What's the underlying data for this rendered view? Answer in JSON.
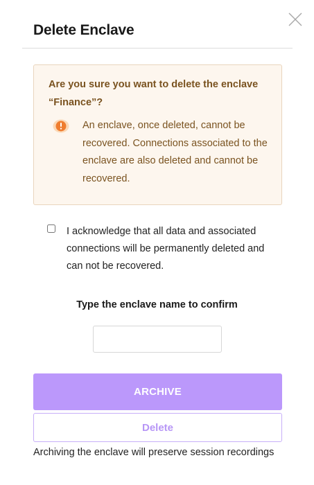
{
  "dialog": {
    "title": "Delete Enclave",
    "close_icon": "close-icon"
  },
  "warning": {
    "heading": "Are you sure you want to delete the enclave “Finance”?",
    "icon": "exclamation-circle-icon",
    "message": "An enclave, once deleted, cannot be recovered. Connections associated to the enclave are also deleted and cannot be recovered.",
    "colors": {
      "background": "#fdf6ee",
      "border": "#e9d5bd",
      "text": "#7a5320",
      "icon": "#ef7d2f"
    }
  },
  "acknowledge": {
    "checked": false,
    "label": "I acknowledge that all data and associated connections will be permanently deleted and can not be recovered."
  },
  "confirm": {
    "label": "Type the enclave name to confirm",
    "value": "",
    "placeholder": ""
  },
  "buttons": {
    "archive_label": "ARCHIVE",
    "delete_label": "Delete"
  },
  "footer_note": "Archiving the enclave will preserve session recordings",
  "colors": {
    "primary_button": "#bb98fb",
    "secondary_button_border": "#c7aef8",
    "secondary_button_text": "#b796f6"
  }
}
